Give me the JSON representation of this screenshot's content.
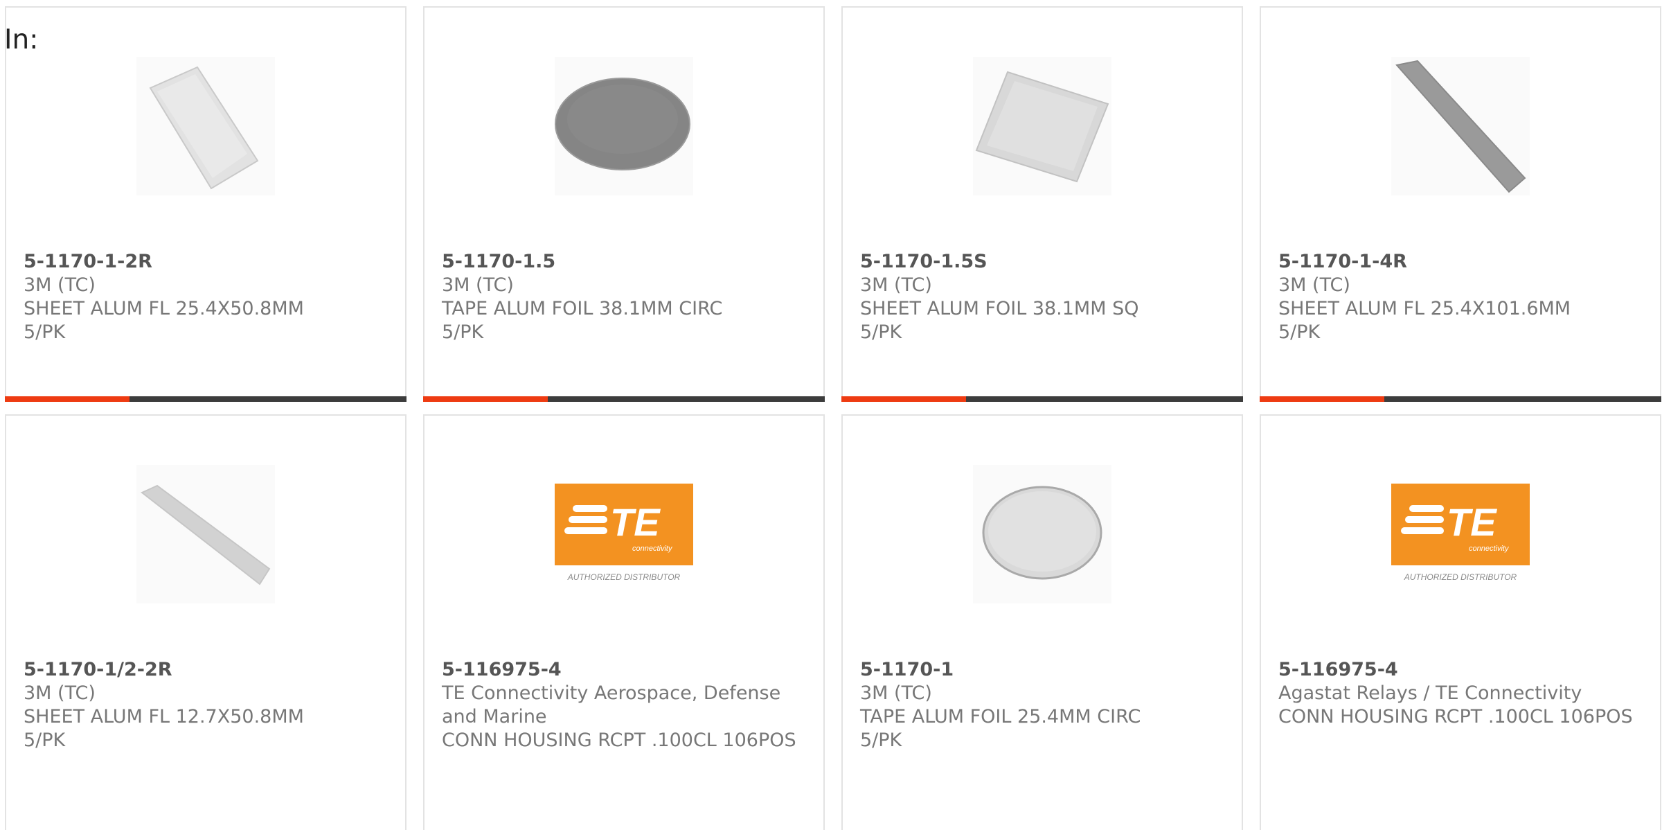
{
  "header": {
    "in_label": "In:"
  },
  "colors": {
    "accent": "#ee3b12",
    "bar": "#3c3c3c",
    "te_orange": "#f39221"
  },
  "progress_fill": 0.31,
  "cards": [
    {
      "pn": "5-1170-1-2R",
      "mfr": "3M (TC)",
      "desc": "SHEET ALUM FL 25.4X50.8MM",
      "pack": "5/PK",
      "image": "foil-rect-sheet"
    },
    {
      "pn": "5-1170-1.5",
      "mfr": "3M (TC)",
      "desc": "TAPE ALUM FOIL 38.1MM CIRC",
      "pack": "5/PK",
      "image": "foil-ellipse-dark"
    },
    {
      "pn": "5-1170-1.5S",
      "mfr": "3M (TC)",
      "desc": "SHEET ALUM FOIL 38.1MM SQ",
      "pack": "5/PK",
      "image": "foil-square"
    },
    {
      "pn": "5-1170-1-4R",
      "mfr": "3M (TC)",
      "desc": "SHEET ALUM FL 25.4X101.6MM",
      "pack": "5/PK",
      "image": "foil-strip-dark"
    },
    {
      "pn": "5-1170-1/2-2R",
      "mfr": "3M (TC)",
      "desc": "SHEET ALUM FL 12.7X50.8MM",
      "pack": "5/PK",
      "image": "foil-strip-light"
    },
    {
      "pn": "5-116975-4",
      "mfr": "TE Connectivity Aerospace, Defense and Marine",
      "desc": "CONN HOUSING RCPT .100CL 106POS",
      "pack": "",
      "image": "te-logo"
    },
    {
      "pn": "5-1170-1",
      "mfr": "3M (TC)",
      "desc": "TAPE ALUM FOIL 25.4MM CIRC",
      "pack": "5/PK",
      "image": "foil-circle"
    },
    {
      "pn": "5-116975-4",
      "mfr": "Agastat Relays / TE Connectivity",
      "desc": "CONN HOUSING RCPT .100CL 106POS",
      "pack": "",
      "image": "te-logo"
    }
  ],
  "te_logo": {
    "wordmark": "TE",
    "tagline": "connectivity",
    "caption": "AUTHORIZED DISTRIBUTOR"
  }
}
